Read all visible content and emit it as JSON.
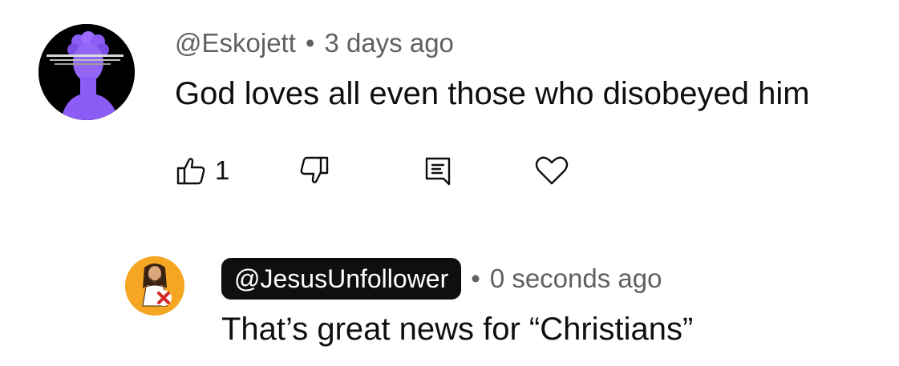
{
  "comment": {
    "author": "@Eskojett",
    "separator": "•",
    "time": "3 days ago",
    "text": "God loves all even those who disobeyed him",
    "avatar_icon": "purple-statue-avatar",
    "like_count": "1",
    "actions": {
      "like_icon": "thumbs-up-icon",
      "dislike_icon": "thumbs-down-icon",
      "reply_icon": "comment-reply-icon",
      "heart_icon": "heart-icon"
    }
  },
  "reply": {
    "author": "@JesusUnfollower",
    "separator": "•",
    "time": "0 seconds ago",
    "text": "That’s great news for “Christians”",
    "avatar_icon": "jesus-unfollow-avatar",
    "colors": {
      "avatar_bg": "#f5a623",
      "handle_bg": "#0f0f0f"
    }
  },
  "colors": {
    "text": "#0f0f0f",
    "muted": "#606060",
    "statue": "#8b5cf6"
  }
}
